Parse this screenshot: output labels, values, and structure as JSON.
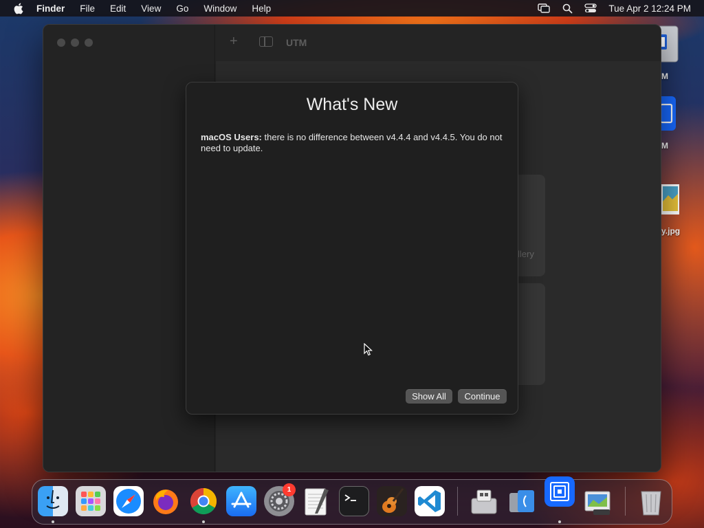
{
  "menubar": {
    "app_name": "Finder",
    "items": [
      "File",
      "Edit",
      "View",
      "Go",
      "Window",
      "Help"
    ],
    "icons": [
      "apple-icon",
      "screen-mirroring-icon",
      "spotlight-search-icon",
      "control-center-icon"
    ],
    "clock": "Tue Apr 2  12:24 PM"
  },
  "desktop": {
    "labels": [
      "M",
      "M",
      "y.jpg"
    ]
  },
  "utm_window": {
    "title": "UTM",
    "gallery_fragment": "llery",
    "toolbar_icons": [
      "add-icon",
      "sidebar-toggle-icon"
    ]
  },
  "whats_new": {
    "title": "What's New",
    "body_bold": "macOS Users:",
    "body_text": " there is no difference between v4.4.4 and v4.4.5. You do not need to update.",
    "show_all_label": "Show All",
    "continue_label": "Continue"
  },
  "dock": {
    "apps": [
      "Finder",
      "Launchpad",
      "Safari",
      "Firefox",
      "Chrome",
      "App Store",
      "System Settings",
      "TextEdit",
      "Terminal",
      "GarageBand",
      "Visual Studio Code",
      "Boot Camp Assistant",
      "Migration Assistant",
      "UTM",
      "Preview",
      "Trash"
    ],
    "settings_badge": "1"
  }
}
